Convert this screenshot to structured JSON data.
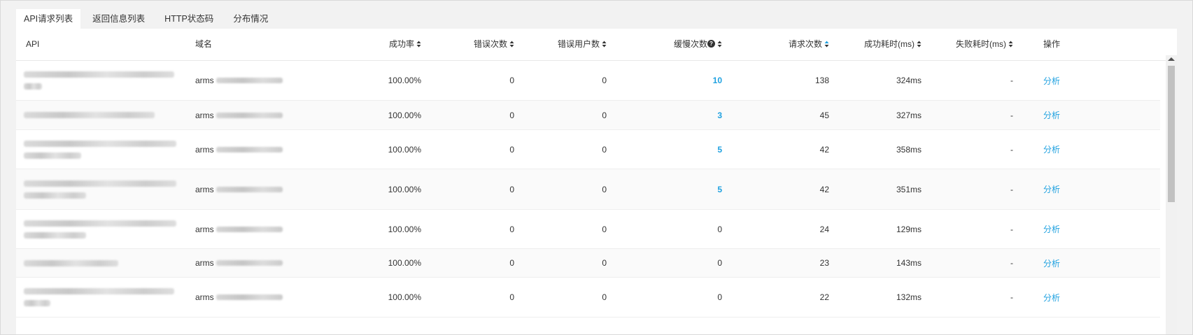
{
  "tabs": [
    {
      "label": "API请求列表",
      "active": true
    },
    {
      "label": "返回信息列表",
      "active": false
    },
    {
      "label": "HTTP状态码",
      "active": false
    },
    {
      "label": "分布情况",
      "active": false
    }
  ],
  "columns": {
    "api": "API",
    "domain": "域名",
    "success_rate": "成功率",
    "error_count": "错误次数",
    "error_users": "错误用户数",
    "slow_count": "缓慢次数",
    "request_count": "请求次数",
    "success_time": "成功耗时(ms)",
    "fail_time": "失败耗时(ms)",
    "action": "操作"
  },
  "colors": {
    "link": "#1fa1e0",
    "sort_active": "#1fa1e0",
    "sort_inactive": "#333333"
  },
  "rows": [
    {
      "domain_prefix": "arms",
      "success_rate": "100.00%",
      "errors": "0",
      "error_users": "0",
      "slow": "10",
      "requests": "138",
      "success_time": "324ms",
      "fail_time": "-",
      "action": "分析"
    },
    {
      "domain_prefix": "arms",
      "success_rate": "100.00%",
      "errors": "0",
      "error_users": "0",
      "slow": "3",
      "requests": "45",
      "success_time": "327ms",
      "fail_time": "-",
      "action": "分析"
    },
    {
      "domain_prefix": "arms",
      "success_rate": "100.00%",
      "errors": "0",
      "error_users": "0",
      "slow": "5",
      "requests": "42",
      "success_time": "358ms",
      "fail_time": "-",
      "action": "分析"
    },
    {
      "domain_prefix": "arms",
      "success_rate": "100.00%",
      "errors": "0",
      "error_users": "0",
      "slow": "5",
      "requests": "42",
      "success_time": "351ms",
      "fail_time": "-",
      "action": "分析"
    },
    {
      "domain_prefix": "arms",
      "success_rate": "100.00%",
      "errors": "0",
      "error_users": "0",
      "slow": "0",
      "requests": "24",
      "success_time": "129ms",
      "fail_time": "-",
      "action": "分析"
    },
    {
      "domain_prefix": "arms",
      "success_rate": "100.00%",
      "errors": "0",
      "error_users": "0",
      "slow": "0",
      "requests": "23",
      "success_time": "143ms",
      "fail_time": "-",
      "action": "分析"
    },
    {
      "domain_prefix": "arms",
      "success_rate": "100.00%",
      "errors": "0",
      "error_users": "0",
      "slow": "0",
      "requests": "22",
      "success_time": "132ms",
      "fail_time": "-",
      "action": "分析"
    }
  ]
}
